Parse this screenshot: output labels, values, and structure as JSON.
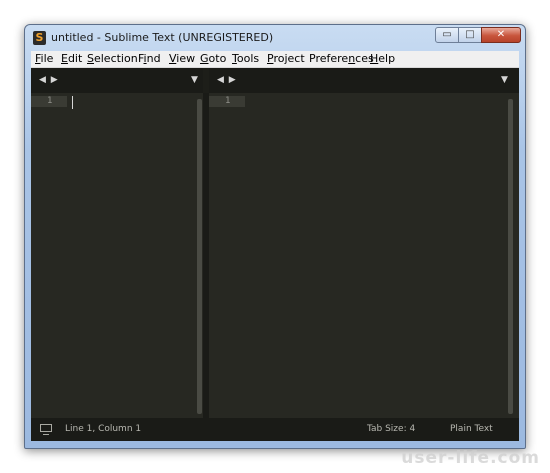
{
  "window": {
    "title": "untitled - Sublime Text (UNREGISTERED)",
    "app_icon_glyph": "S",
    "controls": {
      "minimize_glyph": "▭",
      "maximize_glyph": "□",
      "close_glyph": "✕"
    }
  },
  "menu": {
    "items": [
      {
        "label": "File",
        "mnemonic": "F",
        "rest": "ile"
      },
      {
        "label": "Edit",
        "mnemonic": "E",
        "rest": "dit"
      },
      {
        "label": "Selection",
        "mnemonic": "S",
        "rest": "election"
      },
      {
        "label": "Find",
        "pre": "F",
        "mnemonic": "i",
        "rest": "nd"
      },
      {
        "label": "View",
        "mnemonic": "V",
        "rest": "iew"
      },
      {
        "label": "Goto",
        "mnemonic": "G",
        "rest": "oto"
      },
      {
        "label": "Tools",
        "mnemonic": "T",
        "rest": "ools"
      },
      {
        "label": "Project",
        "mnemonic": "P",
        "rest": "roject"
      },
      {
        "label": "Preferences",
        "pre": "Prefere",
        "mnemonic": "n",
        "rest": "ces"
      },
      {
        "label": "Help",
        "mnemonic": "H",
        "rest": "elp"
      }
    ]
  },
  "editor": {
    "nav_arrows": "◀ ▶",
    "dropdown_arrow": "▼",
    "left_pane": {
      "line_number": "1"
    },
    "right_pane": {
      "line_number": "1"
    }
  },
  "status": {
    "position": "Line 1, Column 1",
    "tab_size": "Tab Size: 4",
    "syntax": "Plain Text"
  },
  "watermark": "user-life.com",
  "colors": {
    "editor_bg": "#272822",
    "chrome_bg": "#1a1b17",
    "close_red": "#c8553c"
  }
}
